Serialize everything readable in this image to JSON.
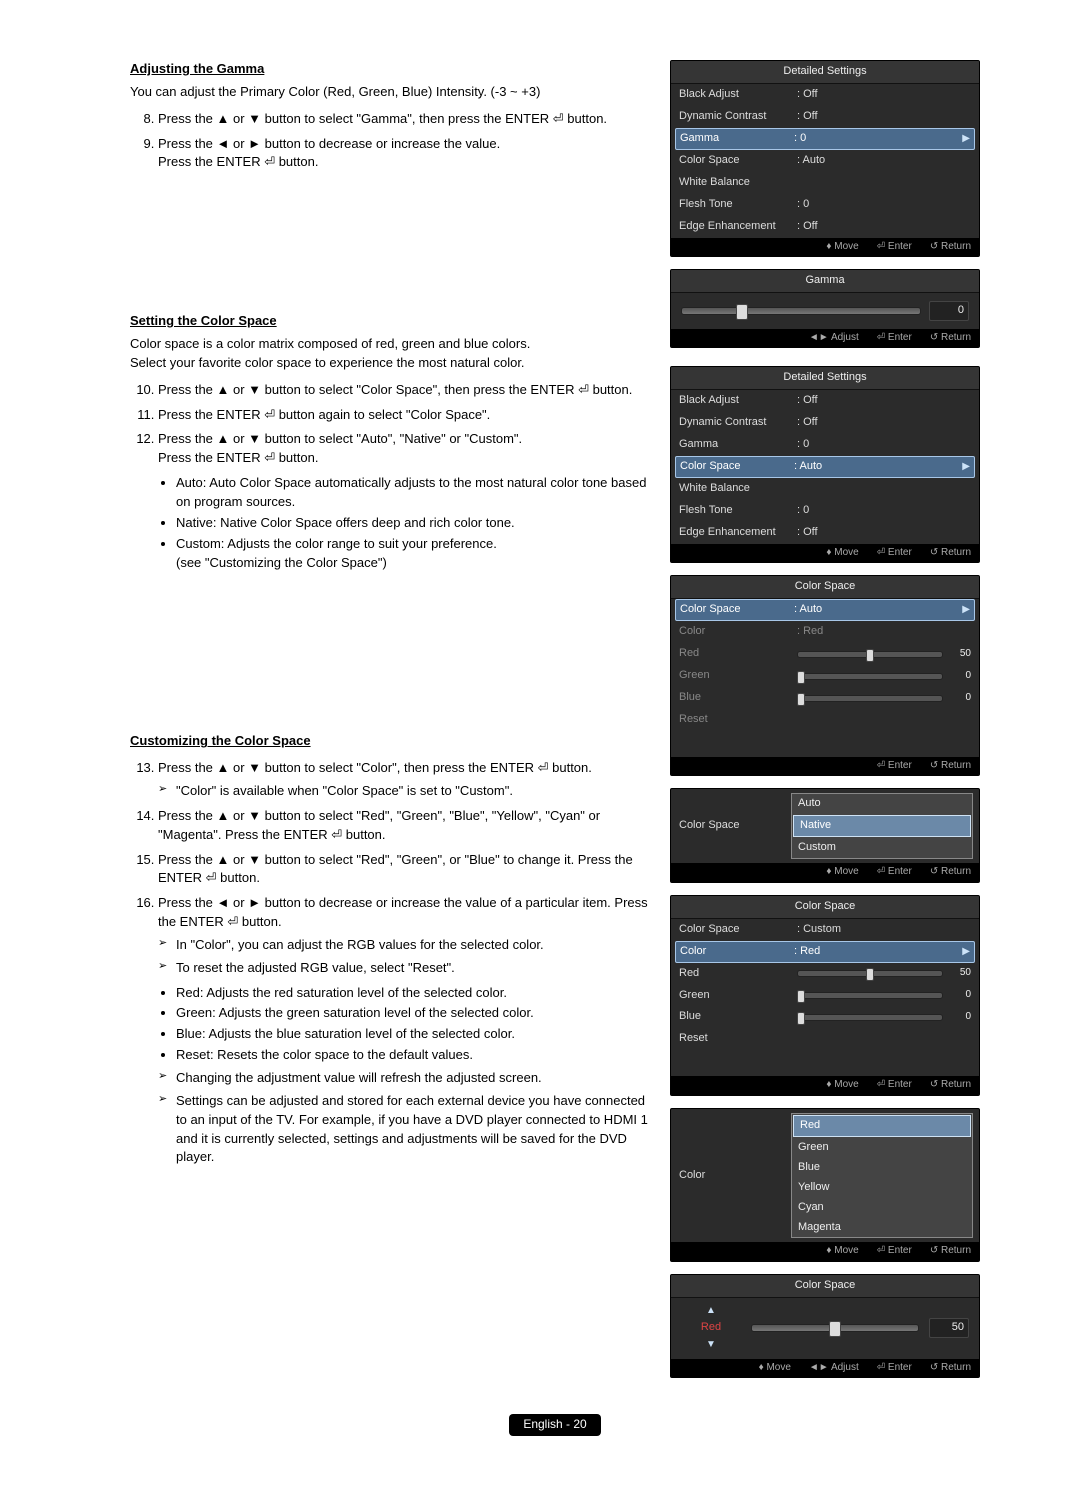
{
  "section1": {
    "title": "Adjusting the Gamma",
    "desc": "You can adjust the Primary Color (Red, Green, Blue) Intensity. (-3 ~ +3)",
    "step8": "Press the ▲ or ▼ button to select \"Gamma\", then press the ENTER ⏎ button.",
    "step9a": "Press the ◄ or ► button to decrease or increase the value.",
    "step9b": "Press the ENTER ⏎ button."
  },
  "panelA": {
    "title": "Detailed Settings",
    "rows": {
      "black": "Black Adjust",
      "black_v": ": Off",
      "dyn": "Dynamic Contrast",
      "dyn_v": ": Off",
      "gamma": "Gamma",
      "gamma_v": ": 0",
      "cspace": "Color Space",
      "cspace_v": ": Auto",
      "wb": "White Balance",
      "flesh": "Flesh Tone",
      "flesh_v": ": 0",
      "edge": "Edge Enhancement",
      "edge_v": ": Off"
    },
    "footer": {
      "move": "Move",
      "enter": "Enter",
      "ret": "Return"
    }
  },
  "panelGamma": {
    "title": "Gamma",
    "value": "0",
    "footer": {
      "adjust": "Adjust",
      "enter": "Enter",
      "ret": "Return"
    },
    "thumb_pct": 25
  },
  "section2": {
    "title": "Setting the Color Space",
    "d1": "Color space is a color matrix composed of red, green and blue colors.",
    "d2": "Select your favorite color space to experience the most natural color.",
    "s10": "Press the ▲ or ▼ button to select \"Color Space\", then press the ENTER ⏎ button.",
    "s11": "Press the ENTER ⏎ button again to select \"Color Space\".",
    "s12a": "Press the ▲ or ▼ button to select \"Auto\", \"Native\" or \"Custom\".",
    "s12b": "Press the ENTER ⏎ button.",
    "b_auto": "Auto: Auto Color Space automatically adjusts to the most natural color tone based on program sources.",
    "b_native": "Native: Native Color Space offers deep and rich color tone.",
    "b_custom1": "Custom: Adjusts the color range to suit your preference.",
    "b_custom2": "(see \"Customizing the Color Space\")"
  },
  "panelB_selected": "Color Space",
  "panelC": {
    "title": "Color Space",
    "rows": {
      "cs": "Color Space",
      "cs_v": ": Auto",
      "col": "Color",
      "col_v": ": Red",
      "red": "Red",
      "red_v": "50",
      "red_pct": 50,
      "green": "Green",
      "green_v": "0",
      "green_pct": 2,
      "blue": "Blue",
      "blue_v": "0",
      "blue_pct": 2,
      "reset": "Reset"
    },
    "footer": {
      "enter": "Enter",
      "ret": "Return"
    }
  },
  "panelD": {
    "label": "Color Space",
    "opts": [
      "Auto",
      "Native",
      "Custom"
    ],
    "selected": "Native",
    "footer": {
      "move": "Move",
      "enter": "Enter",
      "ret": "Return"
    }
  },
  "section3": {
    "title": "Customizing the Color Space",
    "s13": "Press the ▲ or ▼ button to select \"Color\", then press the ENTER ⏎ button.",
    "s13n": "\"Color\" is available when \"Color Space\" is set to \"Custom\".",
    "s14": "Press the ▲ or ▼ button to select \"Red\", \"Green\", \"Blue\", \"Yellow\", \"Cyan\" or \"Magenta\". Press the ENTER ⏎ button.",
    "s15": "Press the ▲ or ▼ button to select \"Red\", \"Green\", or \"Blue\" to change it. Press the ENTER ⏎ button.",
    "s16": "Press the ◄ or ► button to decrease or increase the value of a particular item. Press the ENTER ⏎ button.",
    "n16a": "In \"Color\", you can adjust the RGB values for the selected color.",
    "n16b": "To reset the adjusted RGB value, select \"Reset\".",
    "b_red": "Red: Adjusts the red saturation level of the selected color.",
    "b_green": "Green: Adjusts the green saturation level of the selected color.",
    "b_blue": "Blue: Adjusts the blue saturation level of the selected color.",
    "b_reset": "Reset: Resets the color space to the default values.",
    "nC": "Changing the adjustment value will refresh the adjusted screen.",
    "nD": "Settings can be adjusted and stored for each external device you have connected to an input of the TV. For example, if you have a DVD player connected to HDMI 1 and it is currently selected, settings and adjustments will be saved for the DVD player."
  },
  "panelE": {
    "title": "Color Space",
    "rows": {
      "cs": "Color Space",
      "cs_v": ": Custom",
      "col": "Color",
      "col_v": ": Red",
      "red": "Red",
      "red_v": "50",
      "red_pct": 50,
      "green": "Green",
      "green_v": "0",
      "green_pct": 2,
      "blue": "Blue",
      "blue_v": "0",
      "blue_pct": 2,
      "reset": "Reset"
    },
    "footer": {
      "move": "Move",
      "enter": "Enter",
      "ret": "Return"
    }
  },
  "panelF": {
    "label": "Color",
    "opts": [
      "Red",
      "Green",
      "Blue",
      "Yellow",
      "Cyan",
      "Magenta"
    ],
    "selected": "Red",
    "footer": {
      "move": "Move",
      "enter": "Enter",
      "ret": "Return"
    }
  },
  "panelG": {
    "title": "Color Space",
    "name": "Red",
    "value": "50",
    "thumb_pct": 50,
    "footer": {
      "move": "Move",
      "adjust": "Adjust",
      "enter": "Enter",
      "ret": "Return"
    }
  },
  "pagefoot": "English - 20"
}
